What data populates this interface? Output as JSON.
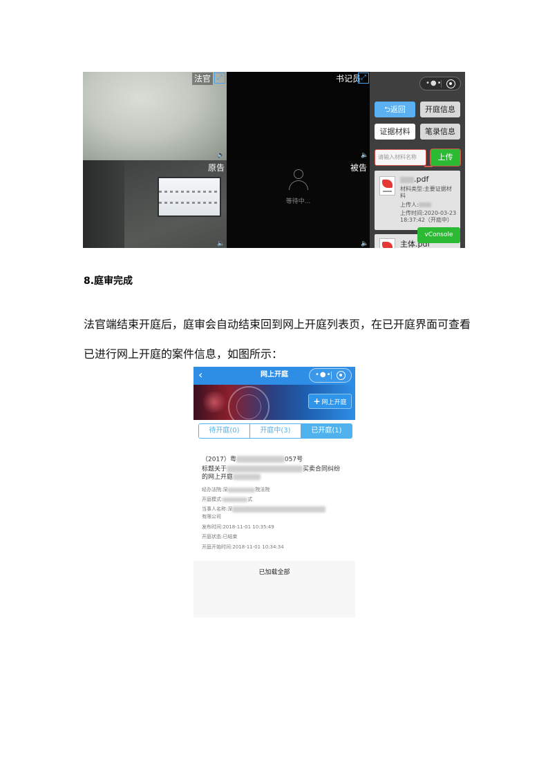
{
  "screenshot1": {
    "panes": {
      "judge": "法官",
      "clerk": "书记员",
      "plaintiff": "原告",
      "defendant": "被告"
    },
    "waiting_text": "等待中...",
    "side": {
      "back_label": "返回",
      "open_info_label": "开庭信息",
      "evidence_label": "证据材料",
      "record_label": "笔录信息",
      "material_placeholder": "请输入材料名称",
      "upload_label": "上传",
      "file1": {
        "name_suffix": ".pdf",
        "type_line1": "材料类型:主要证据材",
        "type_line2": "料",
        "uploader": "上传人:",
        "time_line1": "上传时间:2020-03-23",
        "time_line2": "18:37:42（开庭中）"
      },
      "file2": {
        "name": "主体.pdf"
      },
      "vconsole_label": "vConsole"
    }
  },
  "section": {
    "heading": "8.庭审完成",
    "paragraph_line1": "法官端结束开庭后，庭审会自动结束回到网上开庭列表页，在已开庭界面可查看",
    "paragraph_line2": "已进行网上开庭的案件信息，如图所示："
  },
  "screenshot2": {
    "nav_title": "网上开庭",
    "banner_button": "网上开庭",
    "tabs": [
      {
        "label": "待开庭(0)",
        "active": false
      },
      {
        "label": "开庭中(3)",
        "active": false
      },
      {
        "label": "已开庭(1)",
        "active": true
      }
    ],
    "case": {
      "number_prefix": "（2017）粤",
      "number_suffix": "057号",
      "title_prefix": "标题关于",
      "title_suffix": "买卖合同纠纷",
      "title_line2": "的网上开庭",
      "court_prefix": "经办法院:深",
      "court_suffix": "院法院",
      "mode_prefix": "开庭模式:",
      "mode_suffix": "式",
      "party_prefix": "当事人名称:深",
      "party_line2": "有限公司",
      "publish_time": "发布时间:2018-11-01 10:35:49",
      "status": "开庭状态:已结束",
      "start_time": "开庭开始时间:2018-11-01 10:34:34"
    },
    "load_all": "已加载全部"
  }
}
